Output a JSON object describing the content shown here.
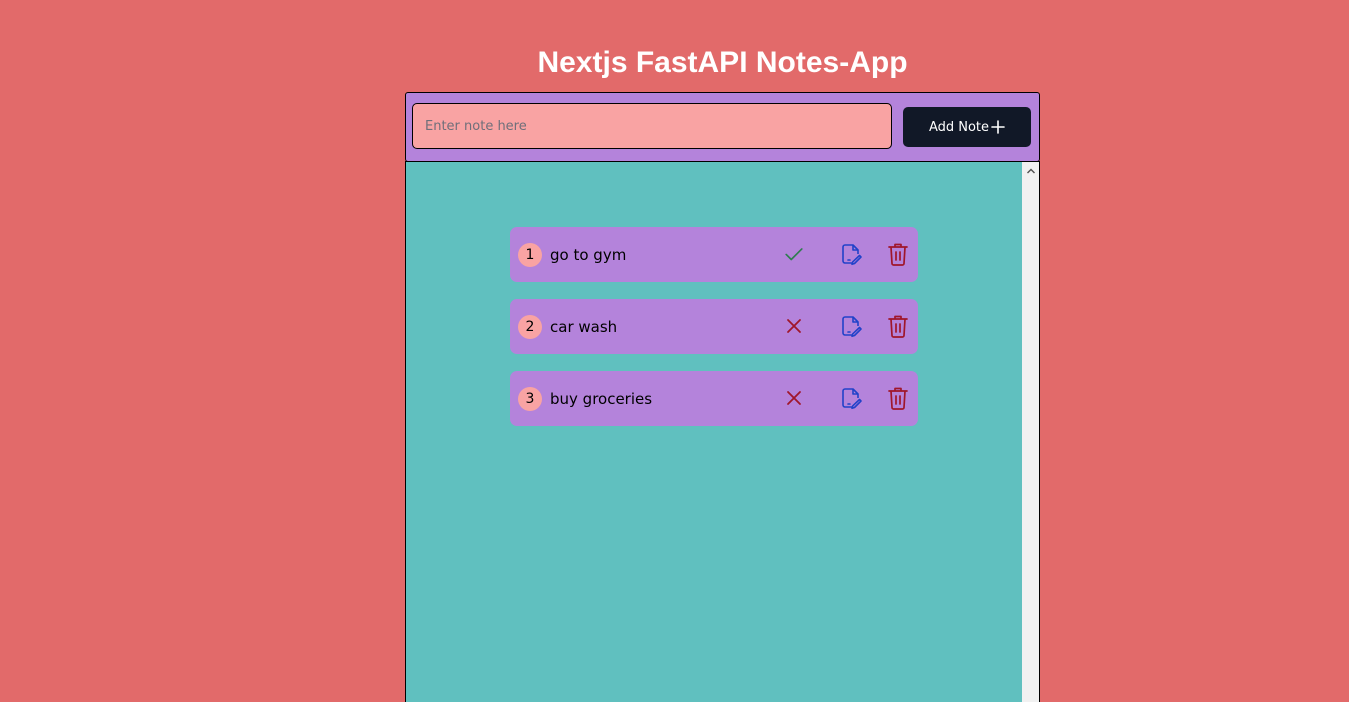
{
  "app": {
    "title": "Nextjs FastAPI Notes-App"
  },
  "input": {
    "placeholder": "Enter note here",
    "value": ""
  },
  "add_button": {
    "label": "Add Note",
    "icon": "plus-icon"
  },
  "notes": [
    {
      "number": "1",
      "text": "go to gym",
      "completed": true,
      "status_icon": "check-icon"
    },
    {
      "number": "2",
      "text": "car wash",
      "completed": false,
      "status_icon": "x-icon"
    },
    {
      "number": "3",
      "text": "buy groceries",
      "completed": false,
      "status_icon": "x-icon"
    }
  ],
  "icons": {
    "edit": "edit-icon",
    "delete": "trash-icon"
  },
  "colors": {
    "background": "#e26a6a",
    "bar": "#b483db",
    "input": "#f9a3a3",
    "panel": "#60c0bf",
    "button": "#111827",
    "check": "#2e7d4f",
    "cross": "#a0162a",
    "edit": "#2142c9",
    "delete": "#a0162a"
  }
}
